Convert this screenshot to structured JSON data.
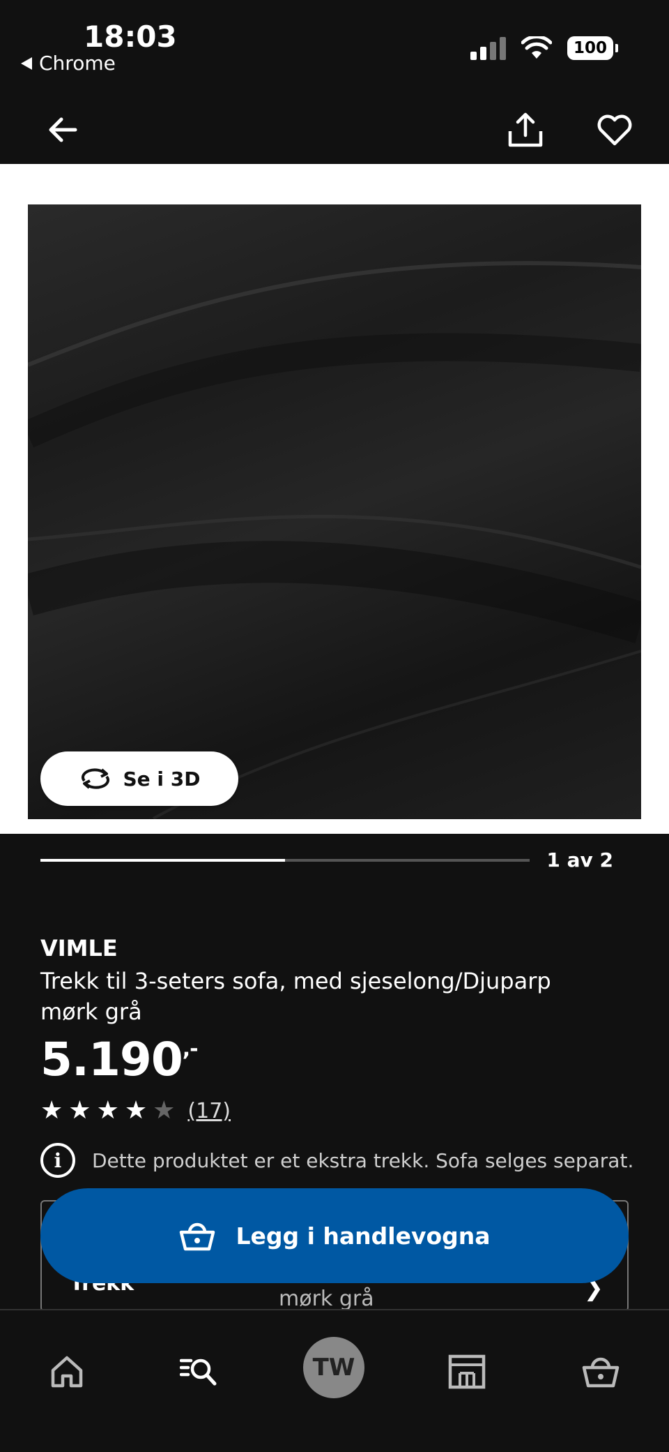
{
  "status_bar": {
    "time": "18:03",
    "back_app": "Chrome",
    "battery": "100"
  },
  "product": {
    "brand": "VIMLE",
    "description_line1": "Trekk til 3-seters sofa, med sjeselong/Djuparp",
    "description_line2": "mørk grå",
    "price_main": "5.190",
    "price_suffix": ",-",
    "rating": 4,
    "rating_max": 5,
    "review_count": "(17)",
    "info_text": "Dette produktet er et ekstra trekk. Sofa selges separat."
  },
  "gallery": {
    "view_3d_label": "Se i 3D",
    "page_indicator": "1 av 2",
    "progress": 0.5
  },
  "variant": {
    "label": "Trekk",
    "value": "mørk grå"
  },
  "cta": {
    "add_to_cart_label": "Legg i handlevogna"
  },
  "bottom_nav": {
    "avatar_initials": "TW"
  },
  "colors": {
    "background": "#111111",
    "accent_blue": "#0058a3"
  }
}
